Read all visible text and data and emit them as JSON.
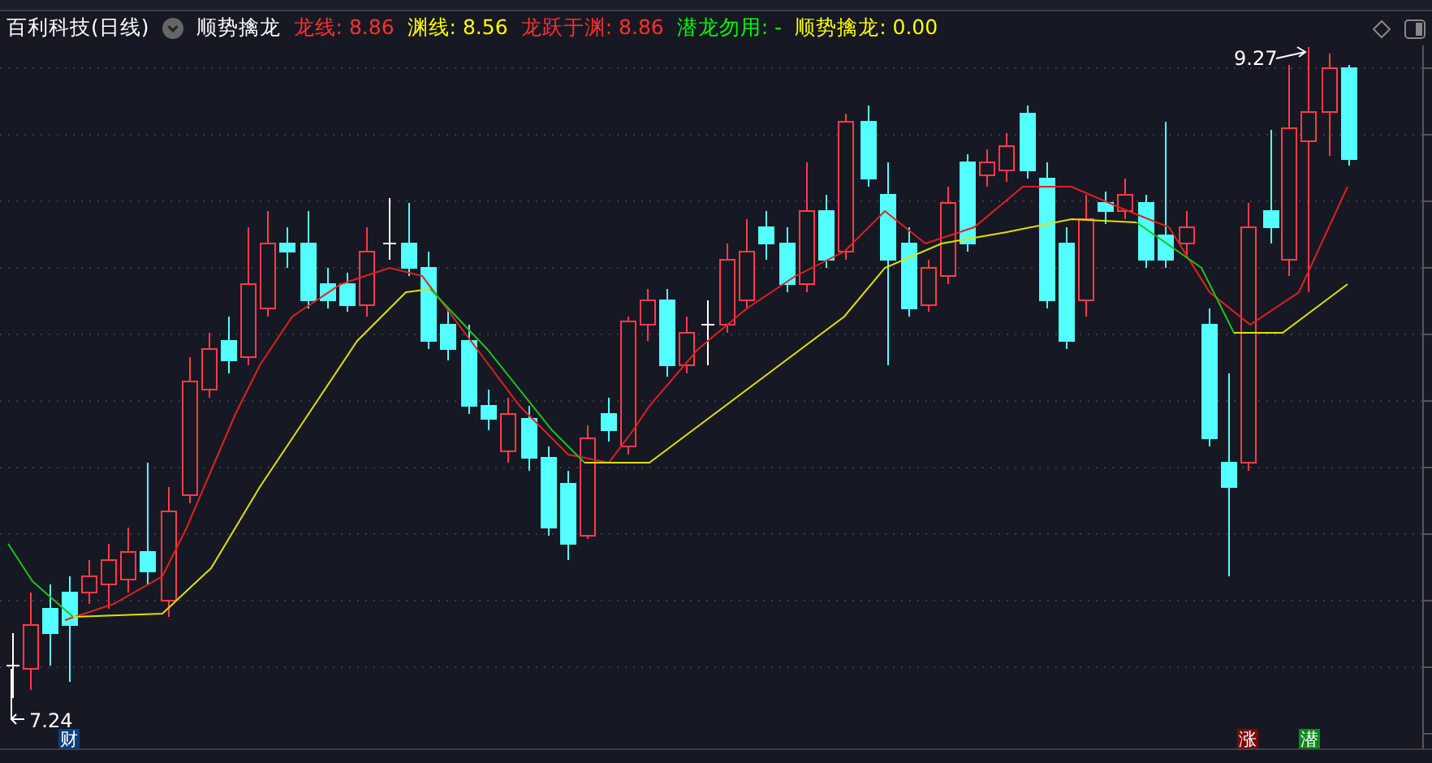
{
  "header": {
    "title": "百利科技(日线)",
    "indicator": "顺势擒龙",
    "values": [
      {
        "text": "龙线: 8.86",
        "color": "#ff3030"
      },
      {
        "text": "渊线: 8.56",
        "color": "#ffff00"
      },
      {
        "text": "龙跃于渊: 8.86",
        "color": "#ff3030"
      },
      {
        "text": "潜龙勿用: -",
        "color": "#00ff00"
      },
      {
        "text": "顺势擒龙: 0.00",
        "color": "#ffff00"
      }
    ]
  },
  "chart": {
    "high_label": "9.27",
    "low_label": "7.24",
    "signals": [
      {
        "text": "财",
        "color": "#0a3f80"
      },
      {
        "text": "涨",
        "color": "#7a0a0a"
      },
      {
        "text": "潜",
        "color": "#0a8a1a"
      }
    ]
  }
}
